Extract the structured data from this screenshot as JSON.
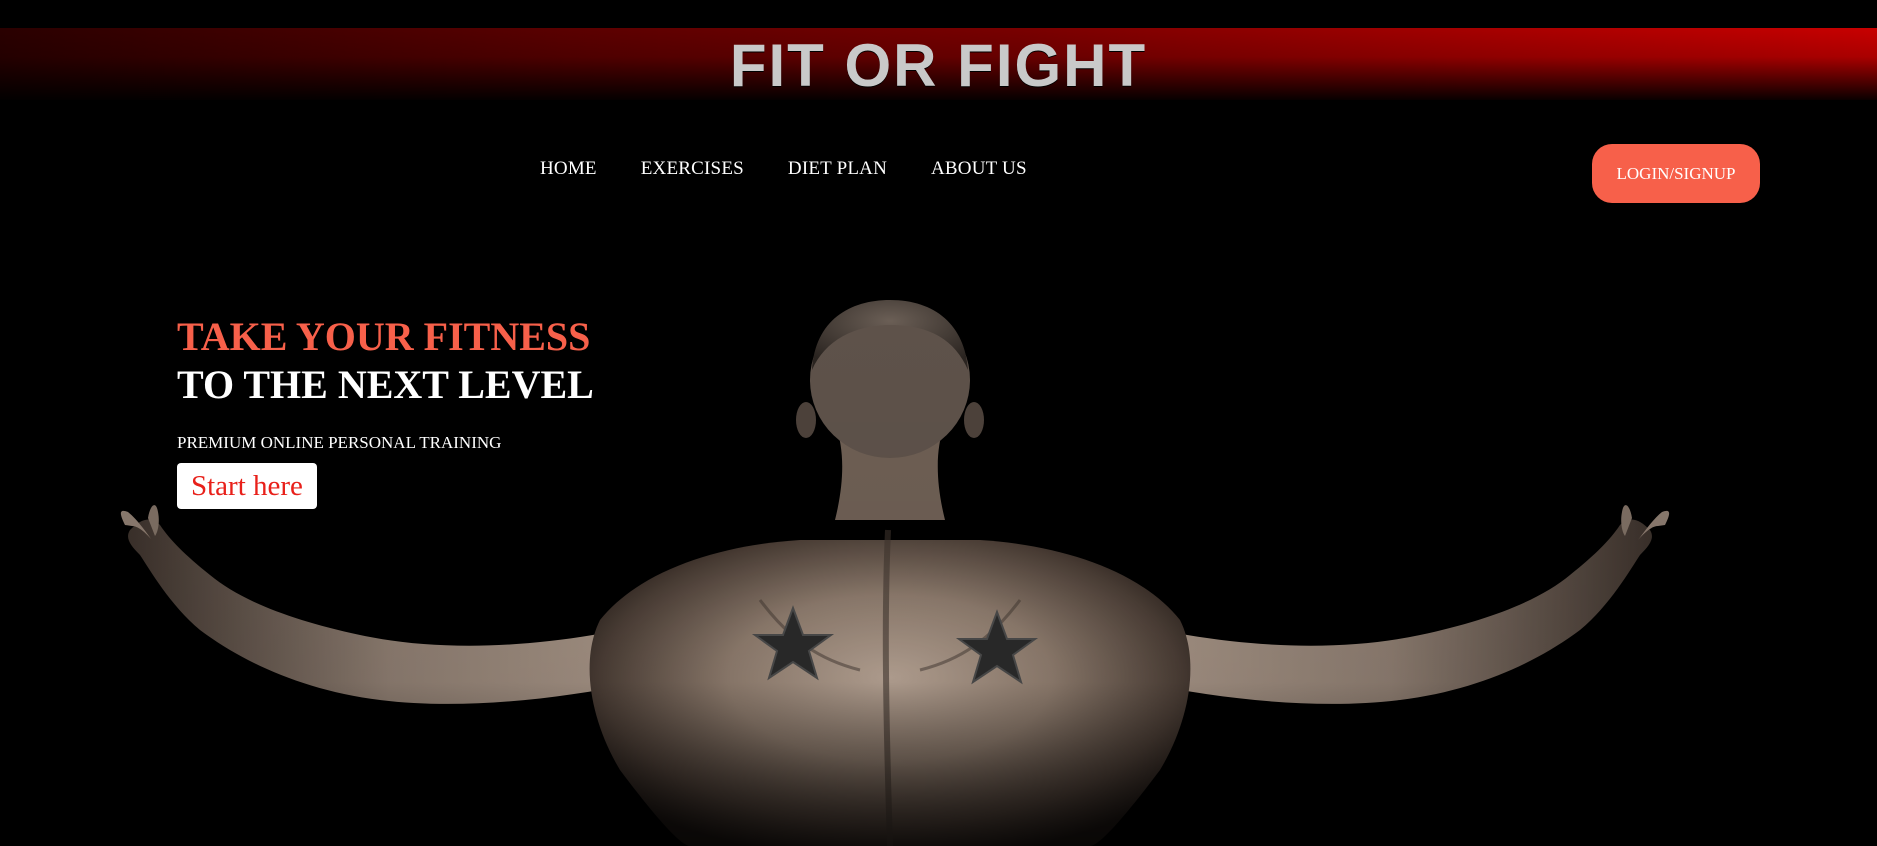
{
  "header": {
    "logo_text": "FIT OR FIGHT"
  },
  "nav": {
    "items": [
      {
        "label": "HOME"
      },
      {
        "label": "EXERCISES"
      },
      {
        "label": "DIET PLAN"
      },
      {
        "label": "ABOUT US"
      }
    ],
    "login_label": "LOGIN/SIGNUP"
  },
  "hero": {
    "headline_line1": "TAKE YOUR FITNESS",
    "headline_line2": "TO THE NEXT LEVEL",
    "subtitle": "PREMIUM ONLINE PERSONAL TRAINING",
    "cta_label": "Start here",
    "image": "muscular-back-photo"
  },
  "colors": {
    "background": "#000000",
    "accent": "#f7604a",
    "banner_red": "#c80000",
    "logo_gray": "#c9c9c9",
    "cta_text": "#e8201a"
  }
}
